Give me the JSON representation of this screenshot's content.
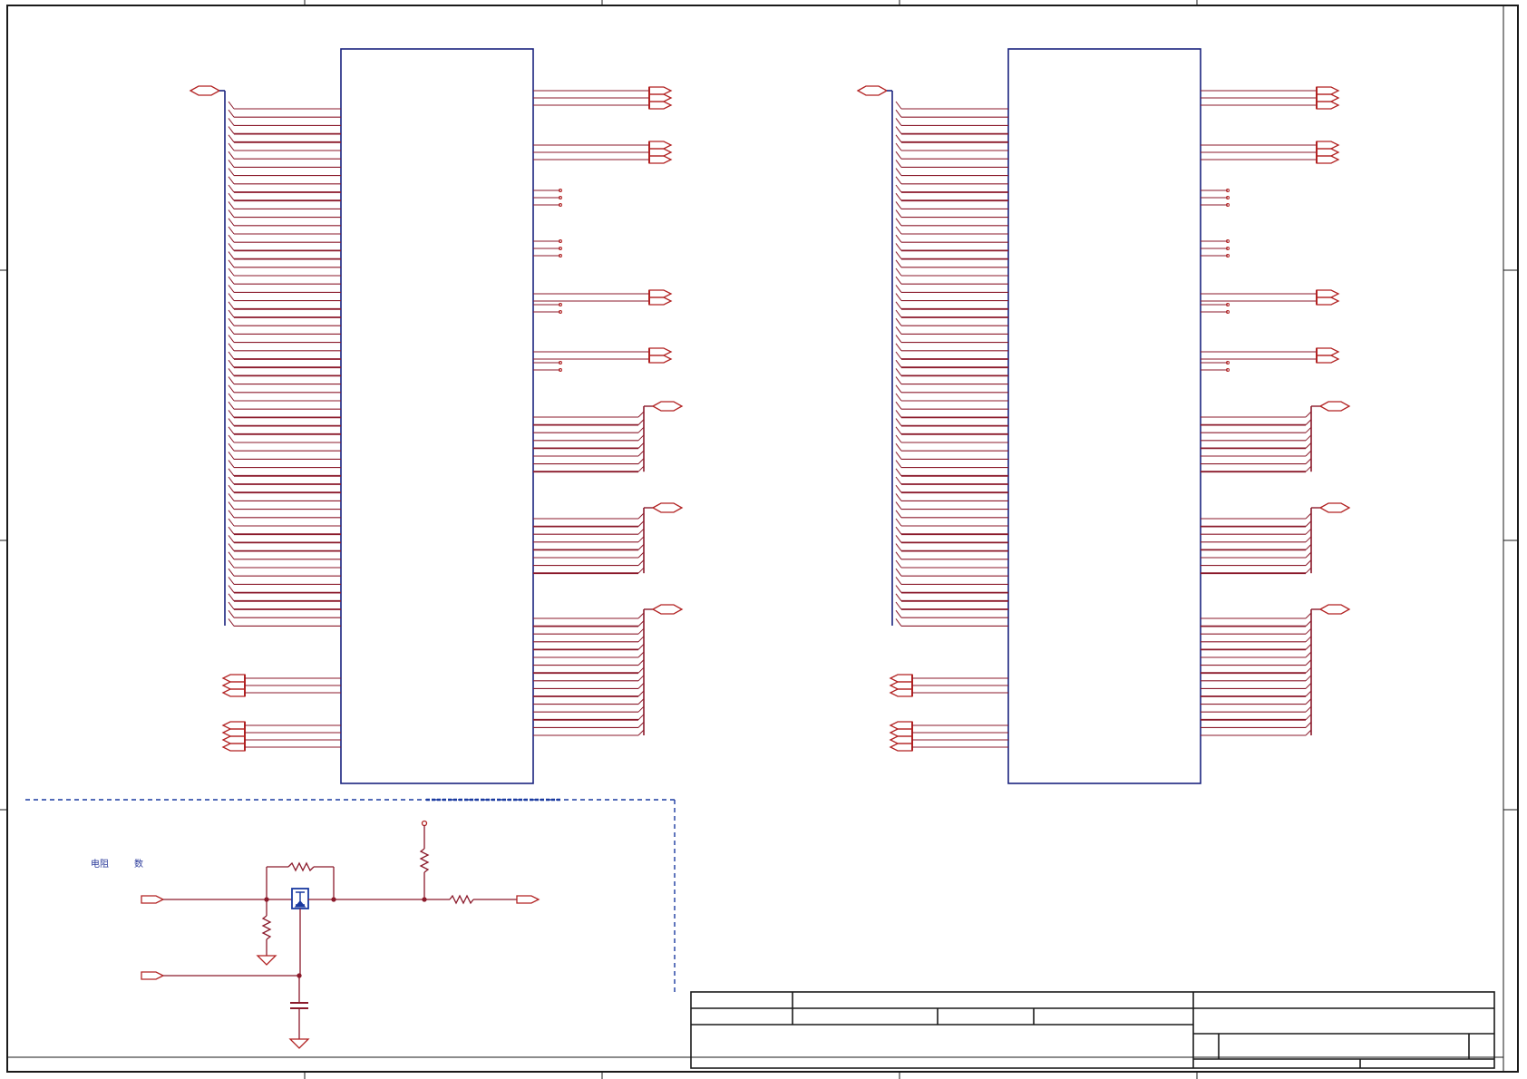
{
  "sheet": {
    "border_color": "#1a1a1a",
    "wire_color": "#8b1a2b",
    "bus_color": "#1a237e",
    "port_color": "#b22222",
    "component_color": "#1a3aa0",
    "ground_color": "#b22222"
  },
  "components": {
    "chip_left": {
      "icon": "ic-body-rectangle"
    },
    "chip_right": {
      "icon": "ic-body-rectangle"
    },
    "mosfet": {
      "icon": "mosfet-symbol"
    }
  },
  "power_section": {
    "note_left": "电阻",
    "note_right": "数"
  },
  "title_block": {
    "cells": []
  }
}
